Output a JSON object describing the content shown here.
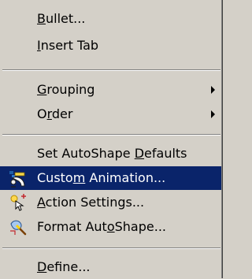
{
  "menu": {
    "items": [
      {
        "name": "bullet",
        "pre": "",
        "key": "B",
        "post": "ullet..."
      },
      {
        "name": "insert-tab",
        "pre": "",
        "key": "I",
        "post": "nsert Tab"
      },
      {
        "name": "grouping",
        "pre": "",
        "key": "G",
        "post": "rouping"
      },
      {
        "name": "order",
        "pre": "O",
        "key": "r",
        "post": "der"
      },
      {
        "name": "set-autoshape-defaults",
        "pre": "Set AutoShape ",
        "key": "D",
        "post": "efaults"
      },
      {
        "name": "custom-animation",
        "pre": "Custo",
        "key": "m",
        "post": " Animation..."
      },
      {
        "name": "action-settings",
        "pre": "",
        "key": "A",
        "post": "ction Settings..."
      },
      {
        "name": "format-autoshape",
        "pre": "Format Aut",
        "key": "o",
        "post": "Shape..."
      },
      {
        "name": "define",
        "pre": "",
        "key": "D",
        "post": "efine..."
      }
    ]
  },
  "colors": {
    "menu_bg": "#d4d0c8",
    "highlight": "#0a246a",
    "highlight_text": "#ffffff"
  },
  "icons": [
    "custom-animation-icon",
    "action-settings-icon",
    "format-autoshape-icon",
    "submenu-arrow-icon"
  ]
}
